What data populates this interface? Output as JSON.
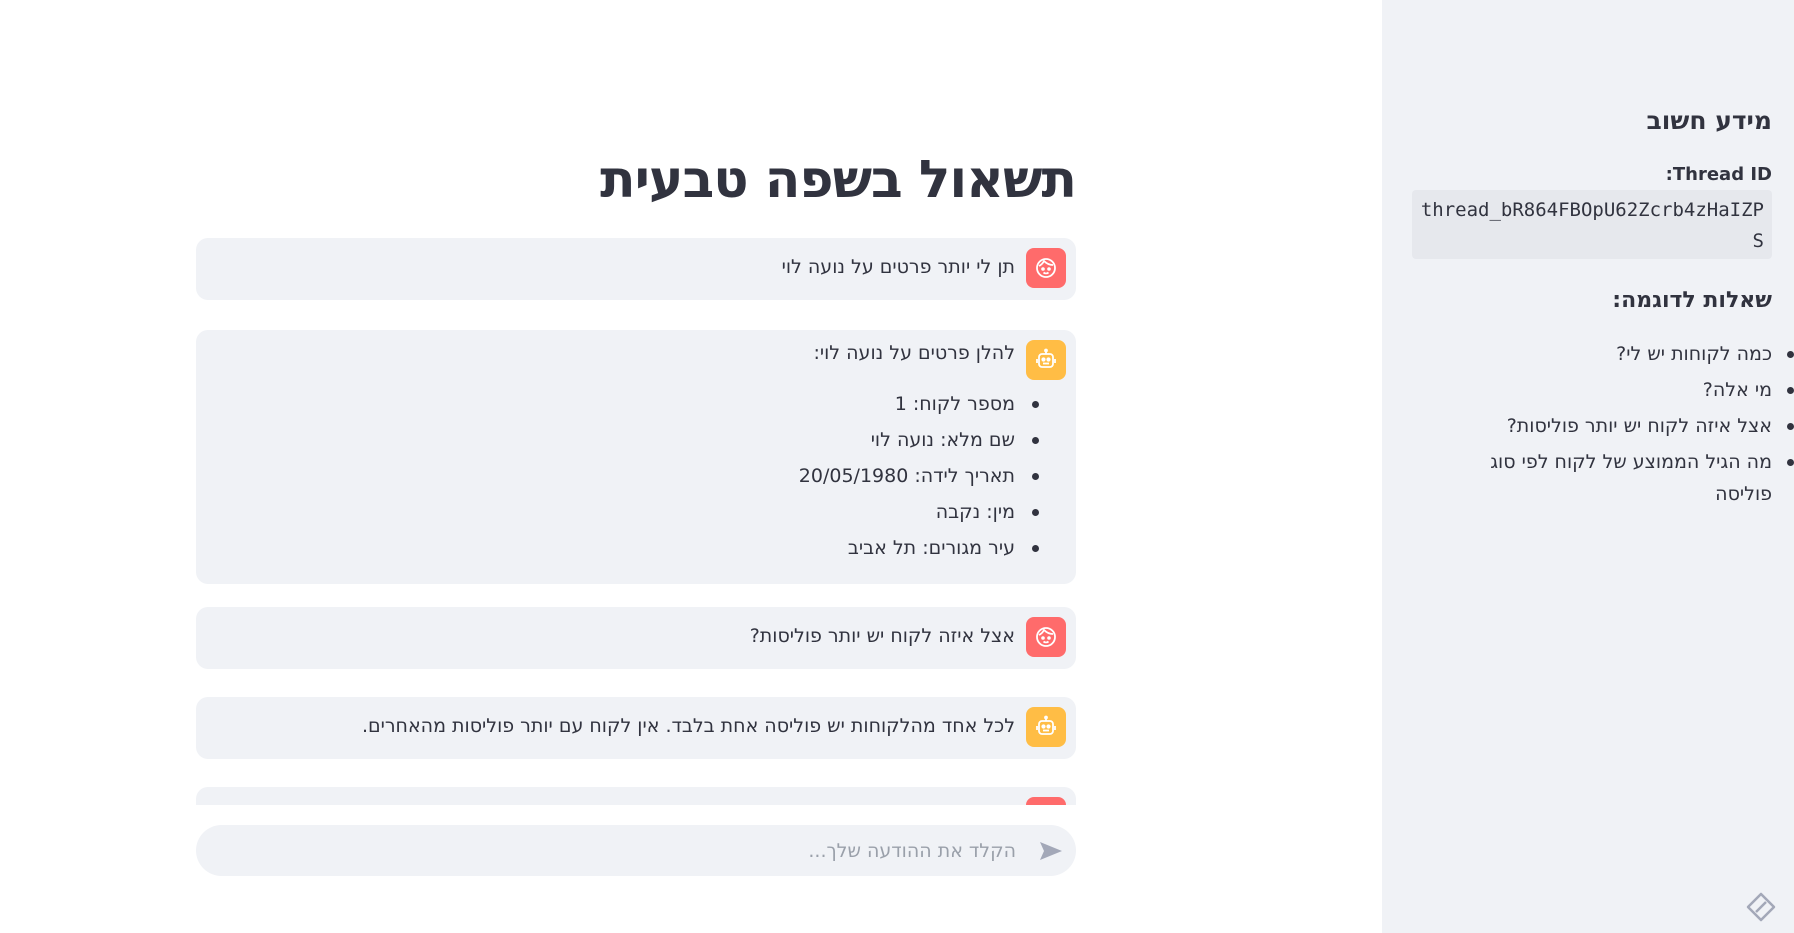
{
  "sidebar": {
    "heading": "מידע חשוב",
    "thread_label": "Thread ID:",
    "thread_id": "thread_bR864FBOpU62Zcrb4zHaIZPS",
    "examples_heading": "שאלות לדוגמה:",
    "examples": [
      "כמה לקוחות יש לי?",
      "מי אלה?",
      "אצל איזה לקוח יש יותר פוליסות?",
      "מה הגיל הממוצע של לקוח לפי סוג פוליסה"
    ]
  },
  "main": {
    "title": "תשאול בשפה טבעית",
    "messages": [
      {
        "role": "user",
        "text": "תן לי יותר פרטים על נועה לוי"
      },
      {
        "role": "assistant",
        "text": "להלן פרטים על נועה לוי:",
        "items": [
          "מספר לקוח: 1",
          "שם מלא: נועה לוי",
          "תאריך לידה: 20/05/1980",
          "מין: נקבה",
          "עיר מגורים: תל אביב"
        ]
      },
      {
        "role": "user",
        "text": "אצל איזה לקוח יש יותר פוליסות?"
      },
      {
        "role": "assistant",
        "text": "לכל אחד מהלקוחות יש פוליסה אחת בלבד. אין לקוח עם יותר פוליסות מהאחרים."
      }
    ],
    "input": {
      "placeholder": "הקלד את ההודעה שלך...",
      "value": ""
    }
  },
  "icons": {
    "user_avatar": "face-icon",
    "bot_avatar": "robot-icon",
    "send": "send-icon",
    "corner": "streamlit-icon"
  },
  "colors": {
    "user_avatar": "#ff6b6b",
    "bot_avatar": "#ffbd45",
    "sidebar_bg": "#f0f2f6",
    "bubble_bg": "#f0f2f6"
  }
}
